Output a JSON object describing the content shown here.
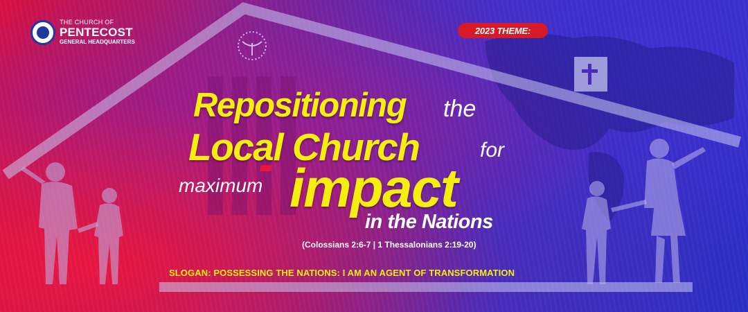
{
  "organization": {
    "line1": "THE CHURCH OF",
    "line2": "PENTECOST",
    "line3": "GENERAL HEADQUARTERS"
  },
  "theme_badge": "2023 THEME:",
  "headline": {
    "word1": "Repositioning",
    "word2": "the",
    "word3": "Local Church",
    "word4": "for",
    "word5": "maximum",
    "word6": "impact",
    "word7": "in the Nations"
  },
  "scripture_ref": "(Colossians 2:6-7  |  1 Thessalonians 2:19-20)",
  "slogan": "SLOGAN: POSSESSING THE NATIONS: I AM AN AGENT OF TRANSFORMATION",
  "icons": [
    "church-logo-icon",
    "dove-emblem-icon",
    "cross-icon",
    "house-outline-icon",
    "family-silhouette-icon"
  ],
  "colors": {
    "headline_yellow": "#f5ee0f",
    "badge_red": "#d81928",
    "background_red": "#d8103f",
    "background_blue": "#2c2fc4"
  }
}
